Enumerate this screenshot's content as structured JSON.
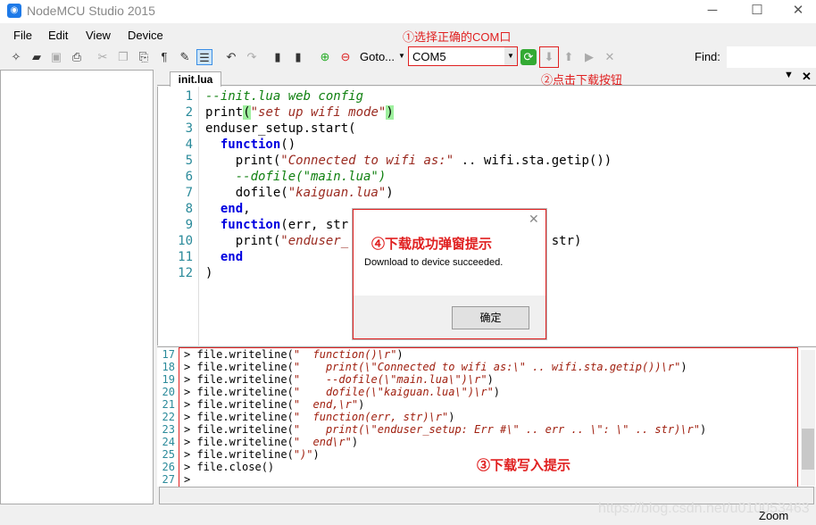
{
  "window": {
    "title": "NodeMCU Studio 2015",
    "minimize": "─",
    "maximize": "☐",
    "close": "✕"
  },
  "menu": [
    "File",
    "Edit",
    "View",
    "Device"
  ],
  "toolbar": {
    "goto_label": "Goto...",
    "com_port": "COM5",
    "find_label": "Find:"
  },
  "annotations": {
    "a1": "①选择正确的COM口",
    "a2": "②点击下载按钮",
    "a3": "③下载写入提示",
    "a4": "④下载成功弹窗提示"
  },
  "editor": {
    "tab": "init.lua",
    "lines": [
      [
        {
          "t": "--init.lua web config",
          "c": "c"
        }
      ],
      [
        {
          "t": "print",
          "c": "p"
        },
        {
          "t": "(",
          "c": "h"
        },
        {
          "t": "\"set up wifi mode\"",
          "c": "s"
        },
        {
          "t": ")",
          "c": "h"
        }
      ],
      [
        {
          "t": "enduser_setup.start(",
          "c": "p"
        }
      ],
      [
        {
          "t": "  ",
          "c": "p"
        },
        {
          "t": "function",
          "c": "k"
        },
        {
          "t": "()",
          "c": "p"
        }
      ],
      [
        {
          "t": "    print(",
          "c": "p"
        },
        {
          "t": "\"Connected to wifi as:\"",
          "c": "s"
        },
        {
          "t": " .. wifi.sta.getip())",
          "c": "p"
        }
      ],
      [
        {
          "t": "    --dofile(\"main.lua\")",
          "c": "c"
        }
      ],
      [
        {
          "t": "    dofile(",
          "c": "p"
        },
        {
          "t": "\"kaiguan.lua\"",
          "c": "s"
        },
        {
          "t": ")",
          "c": "p"
        }
      ],
      [
        {
          "t": "  ",
          "c": "p"
        },
        {
          "t": "end",
          "c": "k"
        },
        {
          "t": ",",
          "c": "p"
        }
      ],
      [
        {
          "t": "  ",
          "c": "p"
        },
        {
          "t": "function",
          "c": "k"
        },
        {
          "t": "(err, str",
          "c": "p"
        }
      ],
      [
        {
          "t": "    print(",
          "c": "p"
        },
        {
          "t": "\"enduser_",
          "c": "s"
        },
        {
          "t": "                   ",
          "c": "p"
        },
        {
          "t": "\": \"",
          "c": "s"
        },
        {
          "t": " .. str)",
          "c": "p"
        }
      ],
      [
        {
          "t": "  ",
          "c": "p"
        },
        {
          "t": "end",
          "c": "k"
        }
      ],
      [
        {
          "t": ")",
          "c": "p"
        }
      ]
    ]
  },
  "console": {
    "lines": [
      {
        "n": "17",
        "a": "> file.writeline(",
        "b": "\"  function()\\r\"",
        "e": ")"
      },
      {
        "n": "18",
        "a": "> file.writeline(",
        "b": "\"    print(\\\"Connected to wifi as:\\\" .. wifi.sta.getip())\\r\"",
        "e": ")"
      },
      {
        "n": "19",
        "a": "> file.writeline(",
        "b": "\"    --dofile(\\\"main.lua\\\")\\r\"",
        "e": ")"
      },
      {
        "n": "20",
        "a": "> file.writeline(",
        "b": "\"    dofile(\\\"kaiguan.lua\\\")\\r\"",
        "e": ")"
      },
      {
        "n": "21",
        "a": "> file.writeline(",
        "b": "\"  end,\\r\"",
        "e": ")"
      },
      {
        "n": "22",
        "a": "> file.writeline(",
        "b": "\"  function(err, str)\\r\"",
        "e": ")"
      },
      {
        "n": "23",
        "a": "> file.writeline(",
        "b": "\"    print(\\\"enduser_setup: Err #\\\" .. err .. \\\": \\\" .. str)\\r\"",
        "e": ")"
      },
      {
        "n": "24",
        "a": "> file.writeline(",
        "b": "\"  end\\r\"",
        "e": ")"
      },
      {
        "n": "25",
        "a": "> file.writeline(",
        "b": "\")\"",
        "e": ")"
      },
      {
        "n": "26",
        "a": "> file.close()",
        "b": "",
        "e": ""
      },
      {
        "n": "27",
        "a": ">",
        "b": "",
        "e": ""
      }
    ]
  },
  "dialog": {
    "message": "Download to device succeeded.",
    "ok": "确定",
    "close": "✕"
  },
  "status": {
    "zoom": "Zoom"
  },
  "watermark": "https://blog.csdn.net/u010053463"
}
